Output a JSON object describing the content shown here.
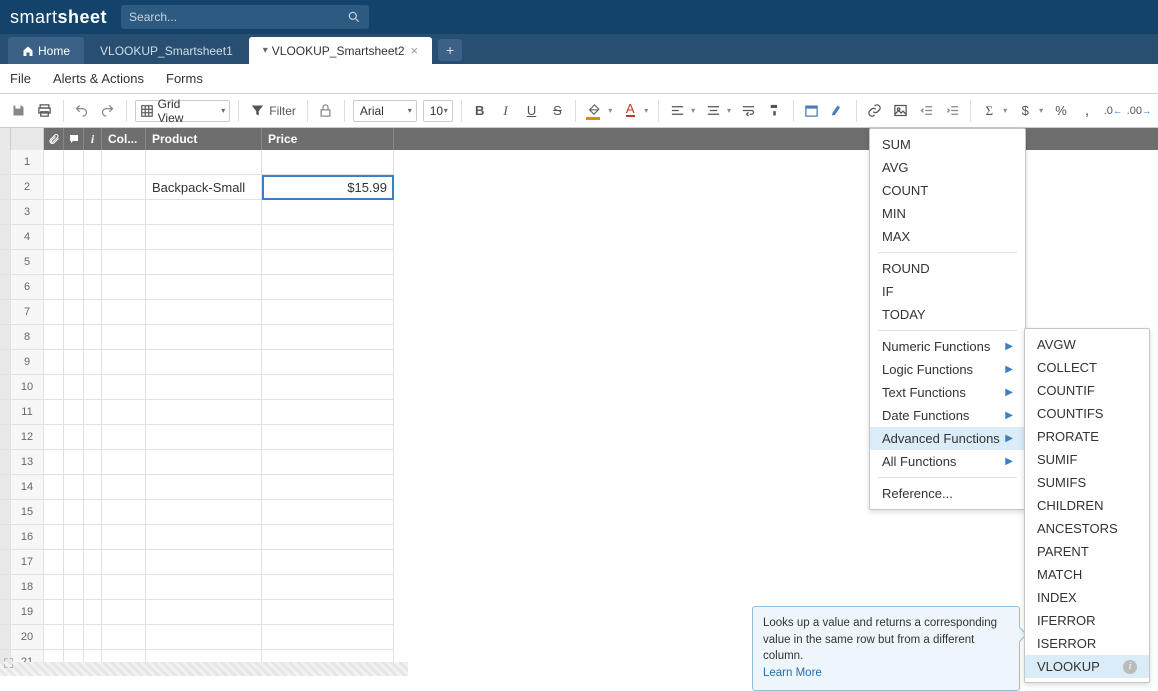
{
  "app": {
    "logoPrefix": "smart",
    "logoBold": "sheet"
  },
  "search": {
    "placeholder": "Search..."
  },
  "tabs": {
    "home": "Home",
    "items": [
      {
        "label": "VLOOKUP_Smartsheet1",
        "active": false
      },
      {
        "label": "VLOOKUP_Smartsheet2",
        "active": true
      }
    ]
  },
  "menubar": [
    "File",
    "Alerts & Actions",
    "Forms"
  ],
  "toolbar": {
    "viewLabel": "Grid View",
    "filterLabel": "Filter",
    "font": "Arial",
    "size": "10"
  },
  "columns": {
    "col": "Col...",
    "product": "Product",
    "price": "Price"
  },
  "rows": [
    {
      "num": "1",
      "product": "",
      "price": ""
    },
    {
      "num": "2",
      "product": "Backpack-Small",
      "price": "$15.99",
      "selected": true
    },
    {
      "num": "3"
    },
    {
      "num": "4"
    },
    {
      "num": "5"
    },
    {
      "num": "6"
    },
    {
      "num": "7"
    },
    {
      "num": "8"
    },
    {
      "num": "9"
    },
    {
      "num": "10"
    },
    {
      "num": "11"
    },
    {
      "num": "12"
    },
    {
      "num": "13"
    },
    {
      "num": "14"
    },
    {
      "num": "15"
    },
    {
      "num": "16"
    },
    {
      "num": "17"
    },
    {
      "num": "18"
    },
    {
      "num": "19"
    },
    {
      "num": "20"
    },
    {
      "num": "21"
    }
  ],
  "sigmaMenu": {
    "group1": [
      "SUM",
      "AVG",
      "COUNT",
      "MIN",
      "MAX"
    ],
    "group2": [
      "ROUND",
      "IF",
      "TODAY"
    ],
    "submenus": [
      "Numeric Functions",
      "Logic Functions",
      "Text Functions",
      "Date Functions",
      "Advanced Functions",
      "All Functions"
    ],
    "highlighted": "Advanced Functions",
    "reference": "Reference..."
  },
  "advMenu": {
    "items": [
      "AVGW",
      "COLLECT",
      "COUNTIF",
      "COUNTIFS",
      "PRORATE",
      "SUMIF",
      "SUMIFS",
      "CHILDREN",
      "ANCESTORS",
      "PARENT",
      "MATCH",
      "INDEX",
      "IFERROR",
      "ISERROR",
      "VLOOKUP"
    ],
    "highlighted": "VLOOKUP"
  },
  "tooltip": {
    "text": "Looks up a value and returns a corresponding value in the same row but from a different column.",
    "link": "Learn More"
  }
}
